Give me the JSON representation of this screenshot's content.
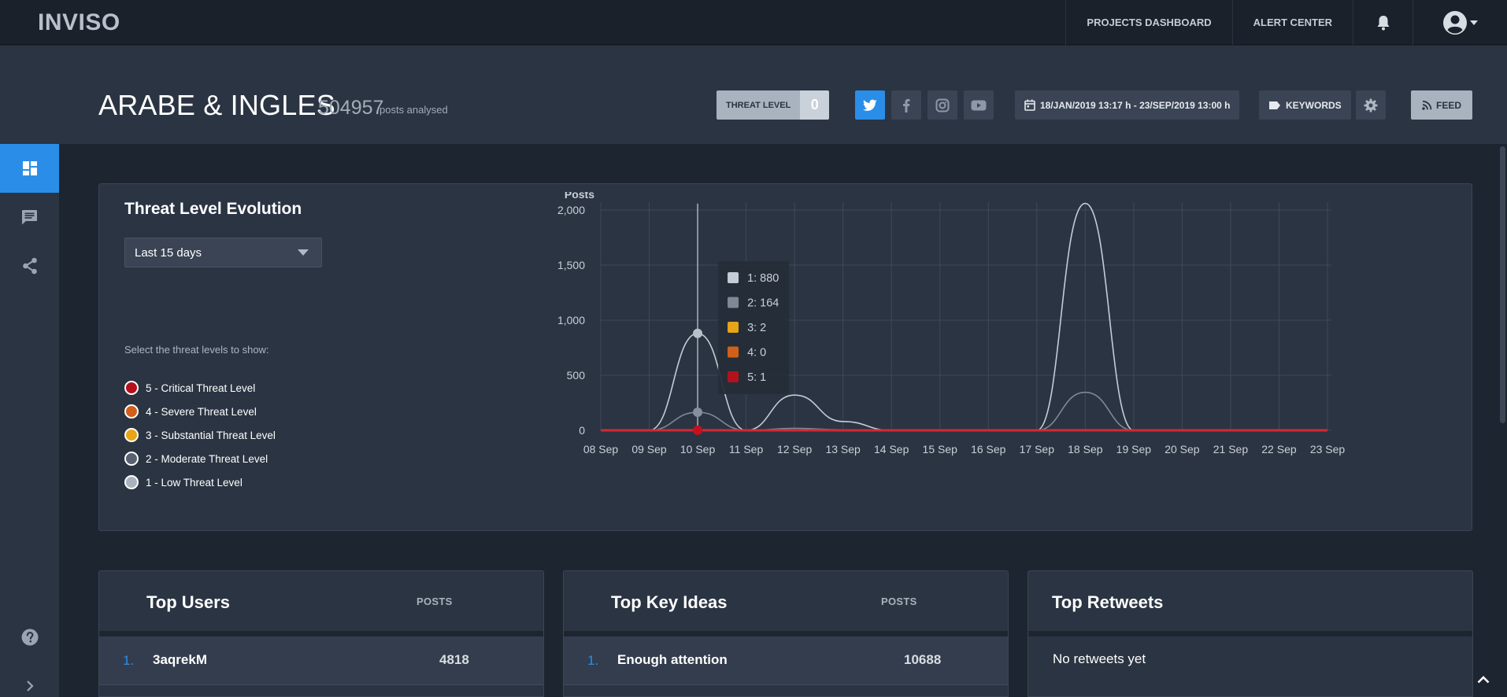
{
  "app": {
    "logo": "INVISO"
  },
  "topnav": {
    "projects": "PROJECTS DASHBOARD",
    "alerts": "ALERT CENTER",
    "bell_icon": "bell-icon",
    "user_icon": "account-circle-icon"
  },
  "header": {
    "title": "ARABE & INGLES",
    "post_count": "504957",
    "post_label": "posts analysed",
    "threat_label": "THREAT LEVEL",
    "threat_value": "0",
    "social": [
      "twitter-icon",
      "facebook-icon",
      "instagram-icon",
      "youtube-icon"
    ],
    "date_range": "18/JAN/2019 13:17 h - 23/SEP/2019 13:00 h",
    "keywords": "KEYWORDS",
    "feed": "FEED"
  },
  "sidebar": {
    "items": [
      "dashboard-icon",
      "chat-icon",
      "share-icon"
    ],
    "help_icon": "help-icon",
    "expand_icon": "chevron-right-icon"
  },
  "threat_panel": {
    "title": "Threat Level Evolution",
    "range_selected": "Last 15 days",
    "select_hint": "Select the threat levels to show:",
    "levels": [
      {
        "label": "5 - Critical Threat Level",
        "color": "#b3121c"
      },
      {
        "label": "4 - Severe Threat Level",
        "color": "#d2601a"
      },
      {
        "label": "3 - Substantial Threat Level",
        "color": "#e8a517"
      },
      {
        "label": "2 - Moderate Threat Level",
        "color": "#5a6170"
      },
      {
        "label": "1 - Low Threat Level",
        "color": "#a9b3c0"
      }
    ]
  },
  "chart_data": {
    "type": "line",
    "ylabel": "Posts",
    "ylim": [
      0,
      2000
    ],
    "yticks": [
      0,
      500,
      1000,
      1500,
      2000
    ],
    "ytick_labels": [
      "0",
      "500",
      "1,000",
      "1,500",
      "2,000"
    ],
    "x": [
      "08 Sep",
      "09 Sep",
      "10 Sep",
      "11 Sep",
      "12 Sep",
      "13 Sep",
      "14 Sep",
      "15 Sep",
      "16 Sep",
      "17 Sep",
      "18 Sep",
      "19 Sep",
      "20 Sep",
      "21 Sep",
      "22 Sep",
      "23 Sep"
    ],
    "series": [
      {
        "name": "1",
        "color": "#c4ccd6",
        "values": [
          0,
          0,
          880,
          0,
          320,
          80,
          0,
          0,
          0,
          0,
          2060,
          0,
          0,
          0,
          0,
          0
        ]
      },
      {
        "name": "2",
        "color": "#7f8896",
        "values": [
          0,
          0,
          164,
          0,
          18,
          5,
          0,
          0,
          0,
          0,
          345,
          0,
          0,
          0,
          0,
          0
        ]
      },
      {
        "name": "3",
        "color": "#e8a517",
        "values": [
          0,
          0,
          2,
          0,
          0,
          0,
          0,
          0,
          0,
          0,
          3,
          0,
          0,
          0,
          0,
          0
        ]
      },
      {
        "name": "4",
        "color": "#d2601a",
        "values": [
          0,
          0,
          0,
          0,
          0,
          0,
          0,
          0,
          0,
          0,
          0,
          0,
          0,
          0,
          0,
          0
        ]
      },
      {
        "name": "5",
        "color": "#d12a34",
        "values": [
          0,
          0,
          1,
          0,
          0,
          0,
          0,
          0,
          0,
          0,
          1,
          0,
          0,
          0,
          0,
          0
        ]
      }
    ],
    "tooltip": {
      "index": 2,
      "items": [
        {
          "label": "1: 880",
          "color": "#c4ccd6"
        },
        {
          "label": "2: 164",
          "color": "#7f8896"
        },
        {
          "label": "3: 2",
          "color": "#e8a517"
        },
        {
          "label": "4: 0",
          "color": "#d2601a"
        },
        {
          "label": "5: 1",
          "color": "#b3121c"
        }
      ]
    },
    "grid": true
  },
  "bottom_panels": {
    "users": {
      "title": "Top Users",
      "header": "POSTS",
      "rank": "1.",
      "name": "3aqrekM",
      "value": "4818"
    },
    "ideas": {
      "title": "Top Key Ideas",
      "header": "POSTS",
      "rank": "1.",
      "name": "Enough attention",
      "value": "10688"
    },
    "retweets": {
      "title": "Top Retweets",
      "empty": "No retweets yet"
    }
  },
  "colors": {
    "accent": "#2a8ee8",
    "background": "#1d2530",
    "panel": "#2b3442"
  }
}
